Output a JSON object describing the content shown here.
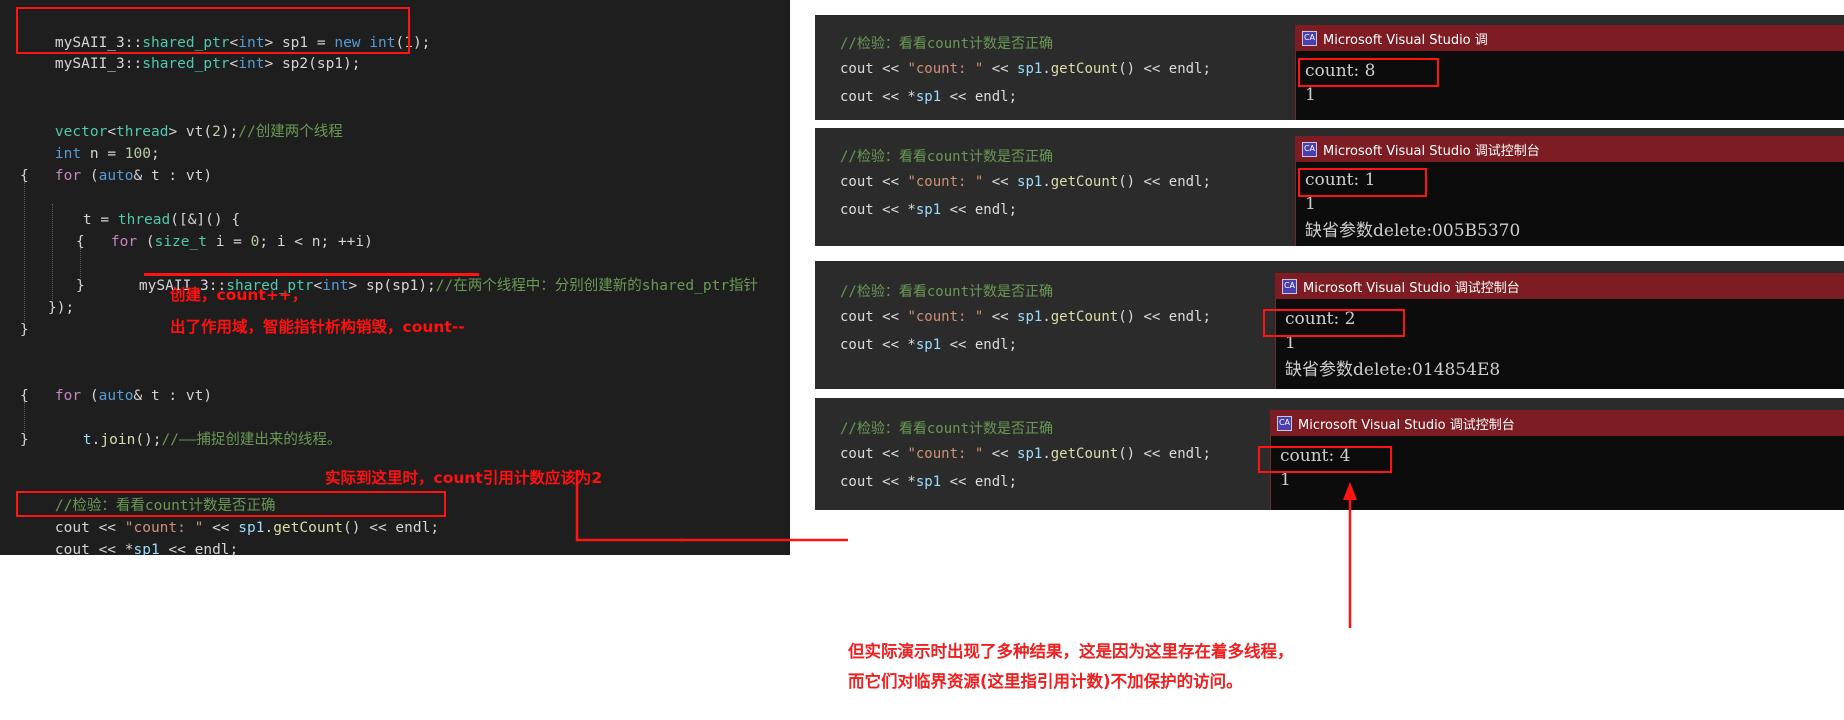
{
  "editor": {
    "top_snippet": [
      "mySAII_3::shared_ptr<int> sp1 = new int(1);",
      "mySAII_3::shared_ptr<int> sp2(sp1);"
    ],
    "lines": [
      "vector<thread> vt(2);//创建两个线程",
      "int n = 100;",
      "for (auto& t : vt)",
      "{",
      "    t = thread([&]() {",
      "        for (size_t i = 0; i < n; ++i)",
      "        {",
      "            mySAII_3::shared_ptr<int> sp(sp1);//在两个线程中：分别创建新的shared_ptr指针",
      "        }",
      "    });",
      "}",
      "for (auto& t : vt)",
      "{",
      "    t.join();//——捕捉创建出来的线程。",
      "}",
      "//检验：看看count计数是否正确",
      "cout << \"count: \" << sp1.getCount() << endl;",
      "cout << *sp1 << endl;"
    ],
    "annotations": [
      "创建，count++，",
      "出了作用域，智能指针析构销毁，count--",
      "实际到这里时，count引用计数应该为2"
    ]
  },
  "panels": [
    {
      "code": [
        "//检验：看看count计数是否正确",
        "cout << \"count: \" << sp1.getCount() << endl;",
        "cout << *sp1 << endl;"
      ],
      "console_title": "Microsoft Visual Studio 调",
      "console_icon": "visual-studio-icon",
      "console_lines": [
        "count: 8",
        "1"
      ],
      "highlight_line": "count: 8"
    },
    {
      "code": [
        "//检验：看看count计数是否正确",
        "cout << \"count: \" << sp1.getCount() << endl;",
        "cout << *sp1 << endl;"
      ],
      "console_title": "Microsoft Visual Studio 调试控制台",
      "console_icon": "visual-studio-icon",
      "console_lines": [
        "count: 1",
        "1",
        "缺省参数delete:005B5370"
      ],
      "highlight_line": "count: 1"
    },
    {
      "code": [
        "//检验：看看count计数是否正确",
        "cout << \"count: \" << sp1.getCount() << endl;",
        "cout << *sp1 << endl;"
      ],
      "console_title": "Microsoft Visual Studio 调试控制台",
      "console_icon": "visual-studio-icon",
      "console_lines": [
        "count: 2",
        "1",
        "缺省参数delete:014854E8"
      ],
      "highlight_line": "count: 2"
    },
    {
      "code": [
        "//检验：看看count计数是否正确",
        "cout << \"count: \" << sp1.getCount() << endl;",
        "cout << *sp1 << endl;"
      ],
      "console_title": "Microsoft Visual Studio 调试控制台",
      "console_icon": "visual-studio-icon",
      "console_lines": [
        "count: 4",
        "1"
      ],
      "highlight_line": "count: 4"
    }
  ],
  "caption": {
    "line1": "但实际演示时出现了多种结果，这是因为这里存在着多线程，",
    "line2": "而它们对临界资源(这里指引用计数)不加保护的访问。"
  },
  "colors": {
    "annotation_red": "#ff1111",
    "editor_bg": "#1e1e1e",
    "panel_bg": "#2b2b2b",
    "console_bg": "#0c0c0c",
    "console_titlebar": "#7d1c22"
  }
}
